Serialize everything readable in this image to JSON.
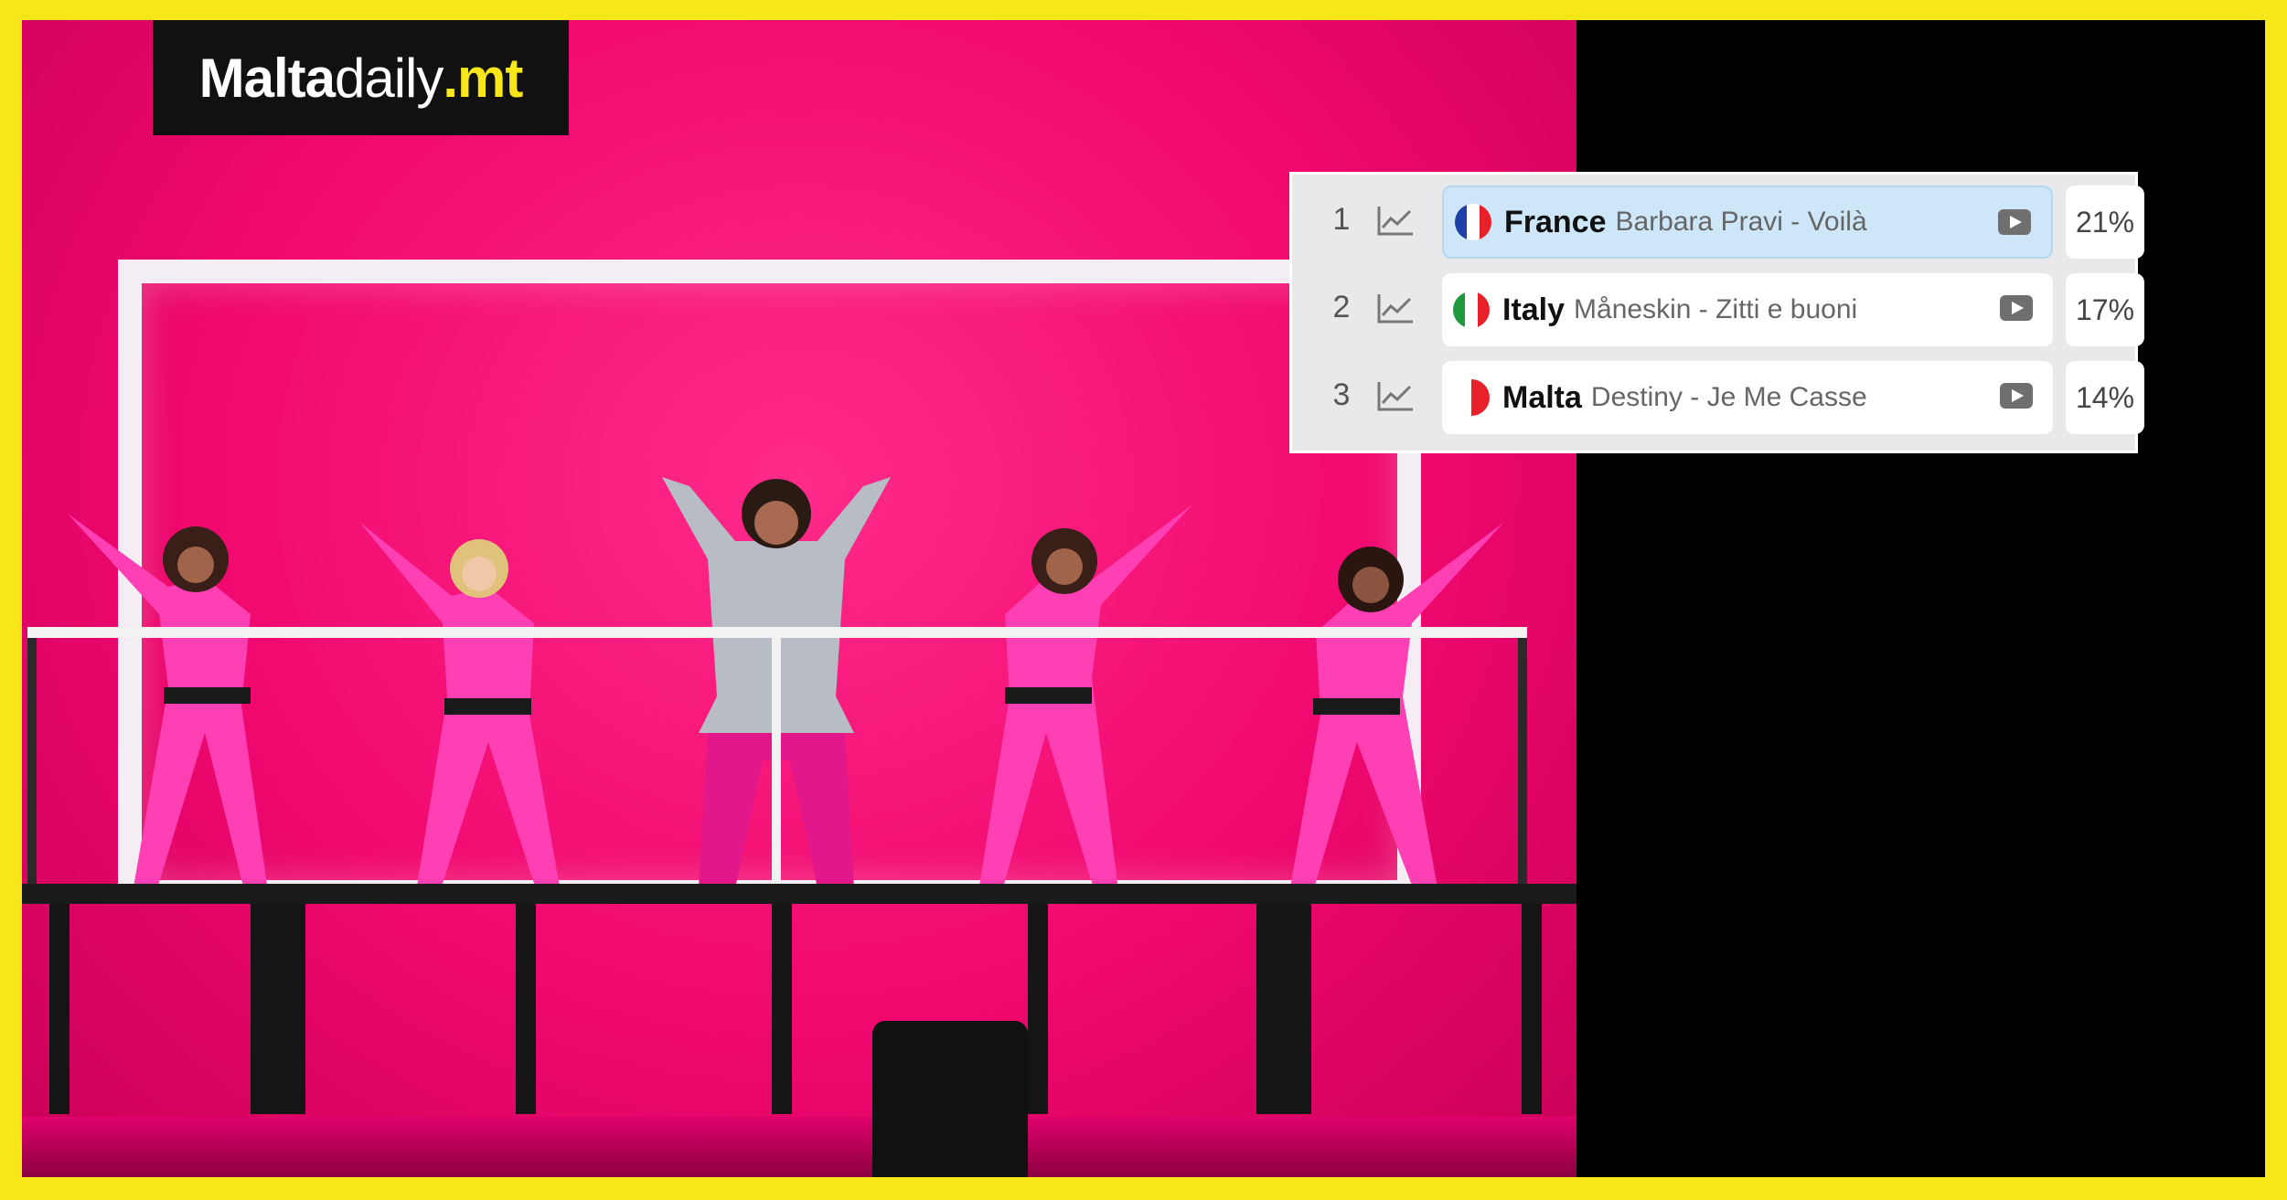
{
  "logo": {
    "part1": "Malta",
    "part2": "daily",
    "part3": ".mt"
  },
  "leaderboard": [
    {
      "rank": "1",
      "country": "France",
      "song": "Barbara Pravi - Voilà",
      "percent": "21%",
      "flag": [
        "#1f3fa8",
        "#ffffff",
        "#e8202a"
      ],
      "active": true
    },
    {
      "rank": "2",
      "country": "Italy",
      "song": "Måneskin - Zitti e buoni",
      "percent": "17%",
      "flag": [
        "#1e9a3c",
        "#ffffff",
        "#e8202a"
      ],
      "active": false
    },
    {
      "rank": "3",
      "country": "Malta",
      "song": "Destiny - Je Me Casse",
      "percent": "14%",
      "flag": [
        "#ffffff",
        "#e8202a"
      ],
      "active": false
    }
  ],
  "colors": {
    "border": "#f7e61a",
    "stage": "#f0086e",
    "highlight": "#cde6f8"
  }
}
